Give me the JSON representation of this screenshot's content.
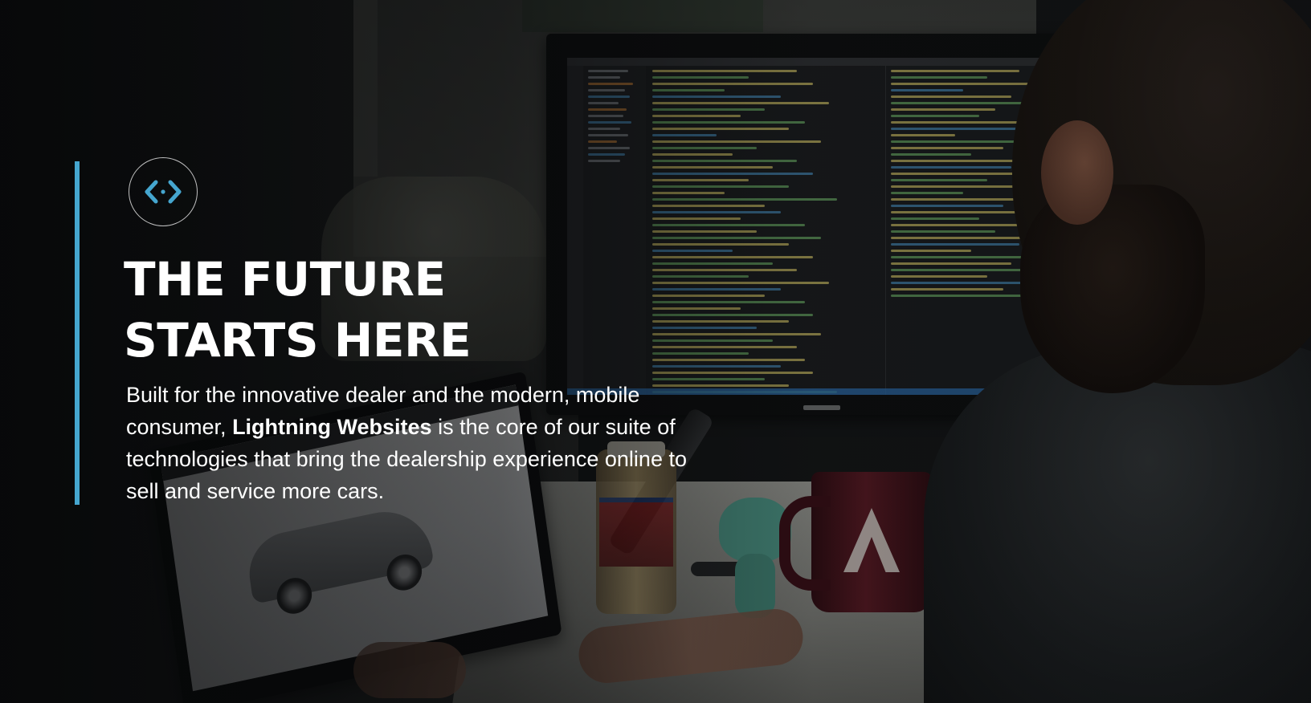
{
  "hero": {
    "icon": "code-brackets-icon",
    "headline_line1": "THE FUTURE",
    "headline_line2": "STARTS HERE",
    "body_before": "Built for the innovative dealer and the modern, mobile consumer, ",
    "body_bold": "Lightning Websites",
    "body_after": " is the core of our suite of technologies that bring the dealership experience online to sell and service more cars."
  },
  "colors": {
    "accent": "#45a6cf",
    "text": "#ffffff",
    "overlay": "#050607"
  }
}
